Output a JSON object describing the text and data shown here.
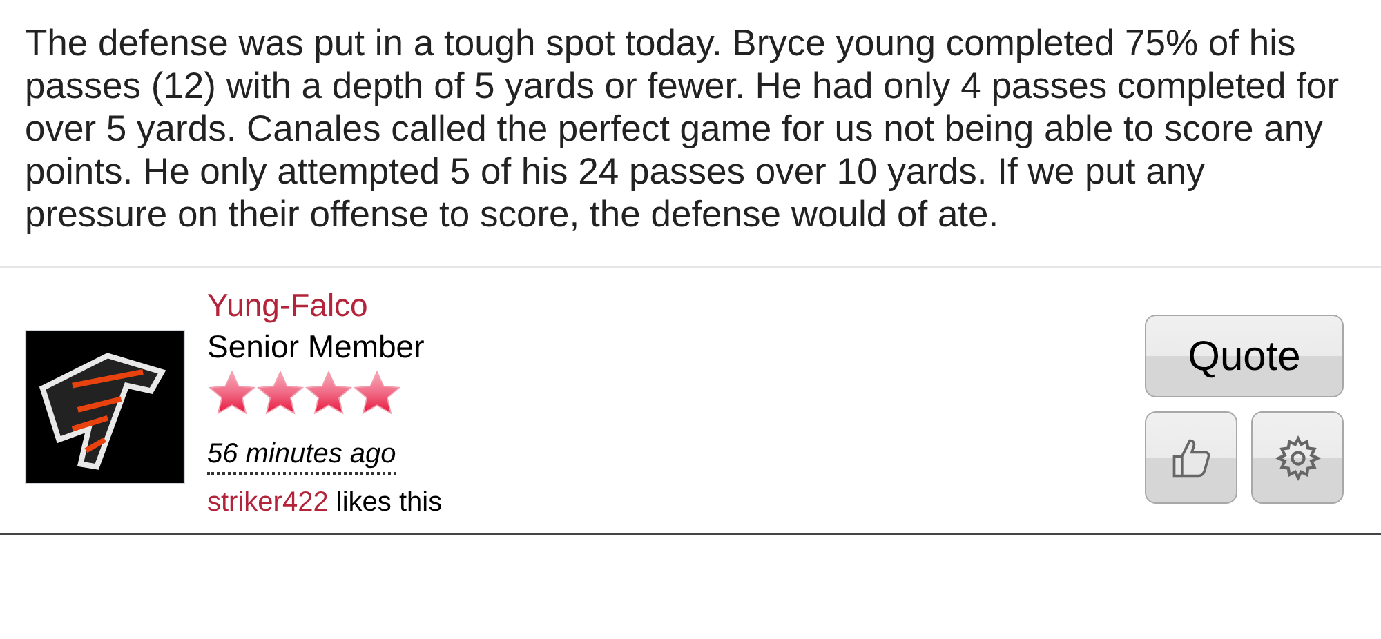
{
  "post": {
    "text": "The defense was put in a tough spot today. Bryce young completed 75% of his passes (12) with a depth of 5 yards or fewer. He had only 4 passes completed for over 5 yards. Canales called the perfect game for us not being able to score any points. He only attempted 5 of his 24 passes over 10 yards. If we put any pressure on their offense to score, the defense would of ate."
  },
  "author": {
    "name": "Yung-Falco",
    "rank": "Senior Member",
    "stars": 4,
    "time": "56 minutes ago"
  },
  "likes": {
    "user": "striker422",
    "text": "likes this"
  },
  "buttons": {
    "quote": "Quote"
  }
}
